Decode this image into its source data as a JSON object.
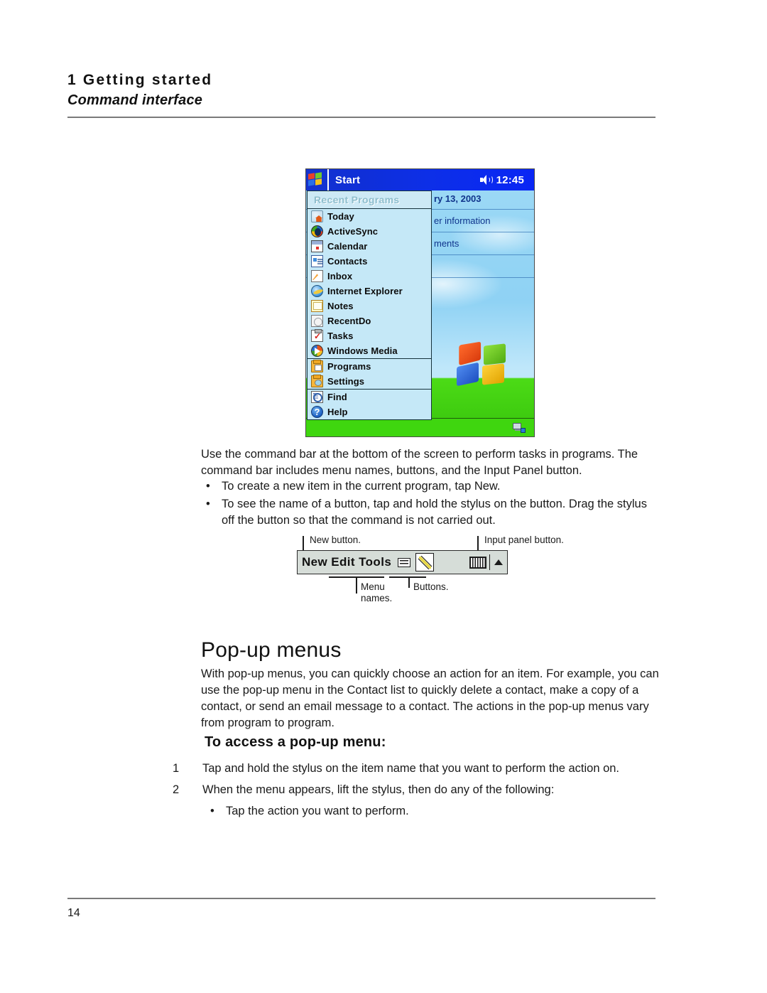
{
  "header": {
    "chapter": "1 Getting started",
    "section": "Command interface"
  },
  "pda_screenshot": {
    "titlebar": {
      "start_label": "Start",
      "time": "12:45",
      "speaker_icon": "speaker-icon",
      "windows_logo_icon": "windows-logo-icon"
    },
    "start_menu": {
      "header": "Recent Programs",
      "groups": [
        {
          "items": [
            {
              "label": "Today",
              "icon": "today-icon"
            },
            {
              "label": "ActiveSync",
              "icon": "activesync-icon"
            },
            {
              "label": "Calendar",
              "icon": "calendar-icon"
            },
            {
              "label": "Contacts",
              "icon": "contacts-icon"
            },
            {
              "label": "Inbox",
              "icon": "inbox-icon"
            },
            {
              "label": "Internet Explorer",
              "icon": "internet-explorer-icon"
            },
            {
              "label": "Notes",
              "icon": "notes-icon"
            },
            {
              "label": "RecentDo",
              "icon": "recentdo-icon"
            },
            {
              "label": "Tasks",
              "icon": "tasks-icon"
            },
            {
              "label": "Windows Media",
              "icon": "windows-media-icon"
            }
          ]
        },
        {
          "items": [
            {
              "label": "Programs",
              "icon": "programs-folder-icon"
            },
            {
              "label": "Settings",
              "icon": "settings-folder-icon"
            }
          ]
        },
        {
          "items": [
            {
              "label": "Find",
              "icon": "find-icon"
            },
            {
              "label": "Help",
              "icon": "help-icon"
            }
          ]
        }
      ]
    },
    "today_screen": {
      "date_fragment": "ry 13, 2003",
      "line1_fragment": "er information",
      "line2_fragment": "ments",
      "connection_icon": "connection-icon",
      "windows_flag_icon": "windows-flag-icon"
    }
  },
  "intro": {
    "paragraph": "Use the command bar at the bottom of the screen to perform tasks in programs. The command bar includes menu names, buttons, and the Input Panel button.",
    "bullets": [
      "To create a new item in the current program, tap New.",
      "To see the name of a button, tap and hold the stylus on the button. Drag the stylus off the button so that the command is not carried out."
    ],
    "bullet_char": "•"
  },
  "command_bar_figure": {
    "menu_names": "New Edit Tools",
    "callouts": {
      "new_button": "New button.",
      "input_panel_button": "Input panel button.",
      "menu_names": "Menu\nnames.",
      "menu_names_line1": "Menu",
      "menu_names_line2": "names.",
      "buttons": "Buttons."
    },
    "icons": {
      "button_one": "soft-keyboard-small-icon",
      "button_two": "pen-highlighter-icon",
      "input_panel": "keyboard-icon",
      "input_panel_arrow": "chevron-up-icon"
    }
  },
  "popup_section": {
    "heading": "Pop-up menus",
    "paragraph": "With pop-up menus, you can quickly choose an action for an item. For example, you can use the pop-up menu in the Contact list to quickly delete a contact, make a copy of a contact, or send an email message to a contact. The actions in the pop-up menus vary from program to program.",
    "subheading": "To access a pop-up menu:",
    "steps": [
      {
        "number": "1",
        "text": "Tap and hold the stylus on the item name that you want to perform the action on."
      },
      {
        "number": "2",
        "text": "When the menu appears, lift the stylus, then do any of the following:"
      }
    ],
    "sub_bullets": [
      "Tap the action you want to perform."
    ],
    "bullet_char": "•"
  },
  "footer": {
    "page_number": "14"
  },
  "colors": {
    "titlebar_blue": "#0d2fe8",
    "menu_bg": "#cfeef8",
    "taskbar_green": "#3fd60f",
    "rule_gray": "#7a7a7a",
    "command_bar_gray": "#d6ddd8"
  }
}
